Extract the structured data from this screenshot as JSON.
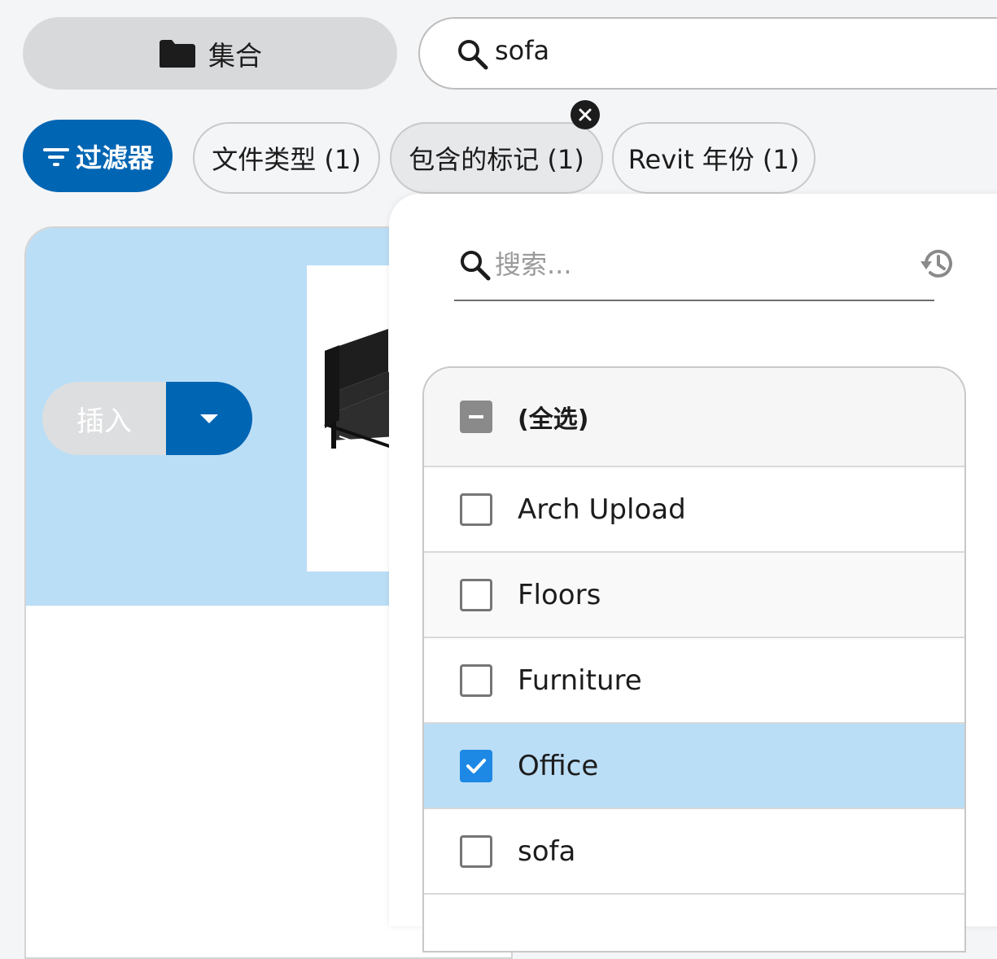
{
  "top_bar": {
    "collection_label": "集合",
    "search_value": "sofa"
  },
  "filters": {
    "filters_label": "过滤器",
    "chips": [
      {
        "label": "文件类型 (1)"
      },
      {
        "label": "包含的标记 (1)"
      },
      {
        "label": "Revit 年份 (1)"
      }
    ]
  },
  "card": {
    "insert_label": "插入"
  },
  "dropdown": {
    "search_placeholder": "搜索...",
    "select_all_label": "(全选)",
    "items": [
      {
        "label": "Arch Upload",
        "checked": false
      },
      {
        "label": "Floors",
        "checked": false
      },
      {
        "label": "Furniture",
        "checked": false
      },
      {
        "label": "Office",
        "checked": true
      },
      {
        "label": "sofa",
        "checked": false
      }
    ]
  },
  "colors": {
    "primary": "#0065b3",
    "selected_row": "#bbdef7",
    "checkbox_checked": "#1e88e5"
  }
}
